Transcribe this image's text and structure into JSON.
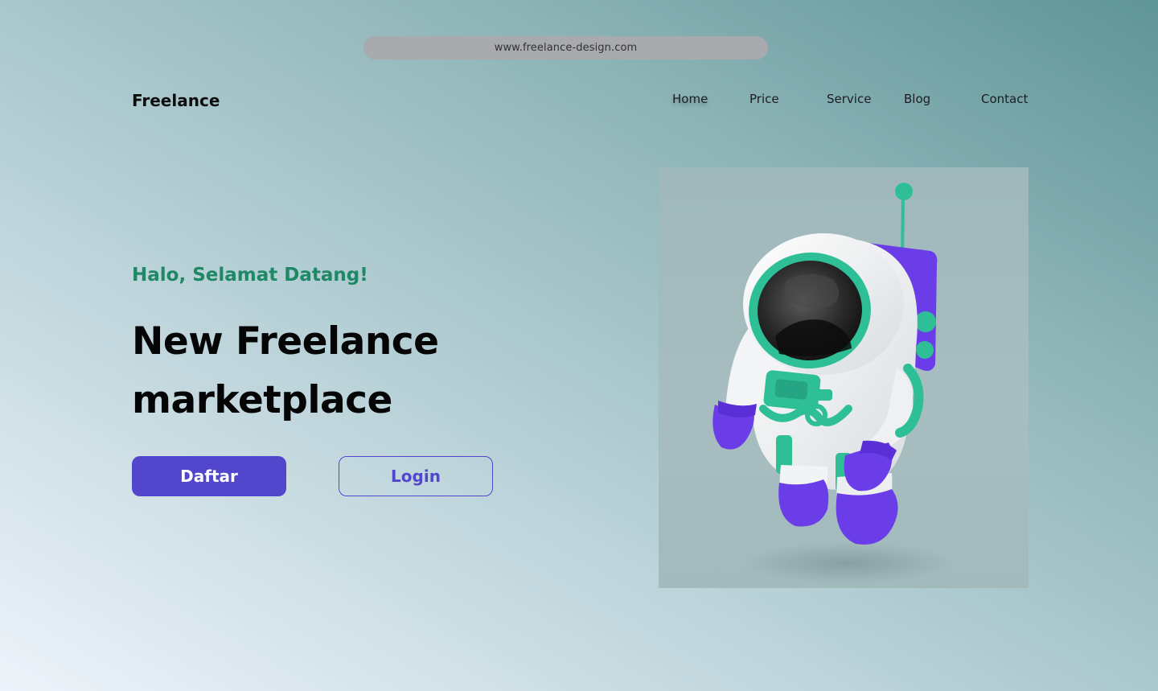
{
  "browser": {
    "url": "www.freelance-design.com"
  },
  "header": {
    "logo": "Freelance",
    "nav": [
      "Home",
      "Price",
      "Service",
      "Blog",
      "Contact"
    ]
  },
  "hero": {
    "greeting": "Halo, Selamat Datang!",
    "title_line1": "New Freelance",
    "title_line2": "marketplace",
    "primary_button": "Daftar",
    "secondary_button": "Login",
    "image_icon": "astronaut-illustration"
  },
  "colors": {
    "accent": "#5247cc",
    "greeting": "#1f8864",
    "teal": "#2fbf97",
    "purple": "#6b3de8"
  }
}
